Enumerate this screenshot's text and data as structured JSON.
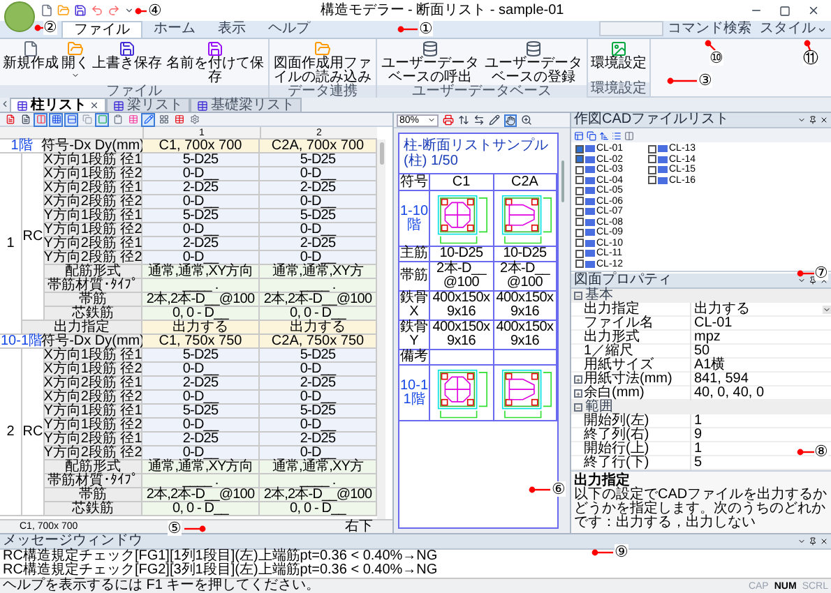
{
  "callouts": [
    "①",
    "②",
    "③",
    "④",
    "⑤",
    "⑥",
    "⑦",
    "⑧",
    "⑨",
    "⑩",
    "⑪"
  ],
  "window": {
    "title": "構造モデラー - 断面リスト - sample-01"
  },
  "menu_tabs": [
    {
      "label": "ファイル",
      "selected": true
    },
    {
      "label": "ホーム",
      "selected": false
    },
    {
      "label": "表示",
      "selected": false
    },
    {
      "label": "ヘルプ",
      "selected": false
    }
  ],
  "command_search": {
    "label": "コマンド検索"
  },
  "style_menu": {
    "label": "スタイル"
  },
  "ribbon": [
    {
      "label": "ファイル",
      "buttons": [
        {
          "label": "新規作成",
          "kind": "new",
          "dropdown": false
        },
        {
          "label": "開く",
          "kind": "open",
          "dropdown": true
        },
        {
          "label": "上書き保存",
          "kind": "save",
          "dropdown": false
        },
        {
          "label": "名前を付けて保存",
          "kind": "saveas",
          "dropdown": false
        }
      ]
    },
    {
      "label": "データ連携",
      "buttons": [
        {
          "label": "図面作成用ファイルの読み込み",
          "kind": "open",
          "dropdown": false
        }
      ]
    },
    {
      "label": "ユーザーデータベース",
      "buttons": [
        {
          "label": "ユーザーデータベースの呼出",
          "kind": "database",
          "dropdown": false
        },
        {
          "label": "ユーザーデータベースの登録",
          "kind": "database",
          "dropdown": false
        }
      ]
    },
    {
      "label": "環境設定",
      "buttons": [
        {
          "label": "環境設定",
          "kind": "image",
          "dropdown": false
        }
      ]
    }
  ],
  "doc_tabs": [
    {
      "label": "柱リスト",
      "selected": true,
      "closable": true
    },
    {
      "label": "梁リスト",
      "selected": false,
      "closable": false
    },
    {
      "label": "基礎梁リスト",
      "selected": false,
      "closable": false
    }
  ],
  "grid": {
    "toolbar": [
      {
        "selected": false
      },
      {
        "selected": false
      },
      {
        "selected": true
      },
      {
        "selected": true
      },
      {
        "selected": true
      },
      {
        "selected": false
      },
      {
        "selected": true
      },
      {
        "selected": false
      },
      {
        "selected": false
      },
      {
        "selected": true
      },
      {
        "selected": false
      },
      {
        "selected": false
      },
      {
        "selected": false
      }
    ],
    "columns": [
      "1",
      "2"
    ],
    "sections": [
      {
        "floor": "1階",
        "number": "1",
        "material": "RC",
        "code_label": "符号-Dx Dy(mm)",
        "values": [
          "C1, 700x 700",
          "C2A, 700x 700"
        ],
        "rows": [
          {
            "label": "X方向1段筋 径1",
            "kind": "bar",
            "values": [
              "5-D25",
              "5-D25"
            ]
          },
          {
            "label": "X方向1段筋 径2",
            "kind": "bar",
            "values": [
              "0-D__",
              "0-D__"
            ]
          },
          {
            "label": "X方向2段筋 径1",
            "kind": "bar",
            "values": [
              "2-D25",
              "2-D25"
            ]
          },
          {
            "label": "X方向2段筋 径2",
            "kind": "bar",
            "values": [
              "0-D__",
              "0-D__"
            ]
          },
          {
            "label": "Y方向1段筋 径1",
            "kind": "bar",
            "values": [
              "5-D25",
              "5-D25"
            ]
          },
          {
            "label": "Y方向1段筋 径2",
            "kind": "bar",
            "values": [
              "0-D__",
              "0-D__"
            ]
          },
          {
            "label": "Y方向2段筋 径1",
            "kind": "bar",
            "values": [
              "2-D25",
              "2-D25"
            ]
          },
          {
            "label": "Y方向2段筋 径2",
            "kind": "bar",
            "values": [
              "0-D__",
              "0-D__"
            ]
          },
          {
            "label": "配筋形式",
            "kind": "detail",
            "values": [
              "通常,通常,XY方向",
              "通常,通常,XY方"
            ]
          },
          {
            "label": "帯筋材質･ﾀｲﾌﾟ",
            "kind": "detail",
            "values": [
              "____ .",
              "____ ."
            ]
          },
          {
            "label": "帯筋",
            "kind": "detail",
            "values": [
              "2本,2本-D__@100",
              "2本,2本-D__@100"
            ]
          },
          {
            "label": "芯鉄筋",
            "kind": "detail",
            "values": [
              "0, 0 - D__",
              "0, 0 - D__"
            ]
          }
        ],
        "output": {
          "label": "出力指定",
          "values": [
            "出力する",
            "出力する"
          ]
        }
      },
      {
        "floor": "10-1階",
        "number": "2",
        "material": "RC",
        "code_label": "符号-Dx Dy(mm)",
        "values": [
          "C1, 750x 750",
          "C2A, 750x 750"
        ],
        "rows": [
          {
            "label": "X方向1段筋 径1",
            "kind": "bar",
            "values": [
              "5-D25",
              "5-D25"
            ]
          },
          {
            "label": "X方向1段筋 径2",
            "kind": "bar",
            "values": [
              "0-D__",
              "0-D__"
            ]
          },
          {
            "label": "X方向2段筋 径1",
            "kind": "bar",
            "values": [
              "2-D25",
              "2-D25"
            ]
          },
          {
            "label": "X方向2段筋 径2",
            "kind": "bar",
            "values": [
              "0-D__",
              "0-D__"
            ]
          },
          {
            "label": "Y方向1段筋 径1",
            "kind": "bar",
            "values": [
              "5-D25",
              "5-D25"
            ]
          },
          {
            "label": "Y方向1段筋 径2",
            "kind": "bar",
            "values": [
              "0-D__",
              "0-D__"
            ]
          },
          {
            "label": "Y方向2段筋 径1",
            "kind": "bar",
            "values": [
              "2-D25",
              "2-D25"
            ]
          },
          {
            "label": "Y方向2段筋 径2",
            "kind": "bar",
            "values": [
              "0-D__",
              "0-D__"
            ]
          },
          {
            "label": "配筋形式",
            "kind": "detail",
            "values": [
              "通常,通常,XY方向",
              "通常,通常,XY方"
            ]
          },
          {
            "label": "帯筋材質･ﾀｲﾌﾟ",
            "kind": "detail",
            "values": [
              "____ .",
              "____ ."
            ]
          },
          {
            "label": "帯筋",
            "kind": "detail",
            "values": [
              "2本,2本-D__@100",
              "2本,2本-D__@100"
            ]
          },
          {
            "label": "芯鉄筋",
            "kind": "detail",
            "values": [
              "0, 0 - D__",
              "0, 0 - D__"
            ]
          }
        ]
      }
    ],
    "footer": {
      "left": "C1, 700x 700",
      "right": "右下"
    }
  },
  "preview": {
    "zoom": "80%",
    "title": "柱-断面リストサンプル(柱) 1/50",
    "header": [
      "符号",
      "C1",
      "C2A"
    ],
    "groups": [
      {
        "label": "1-10階",
        "sections": [
          {
            "kind": "octagon"
          },
          {
            "kind": "trapezoid"
          }
        ],
        "rows": [
          {
            "label": "主筋",
            "values": [
              "10-D25",
              "10-D25"
            ]
          },
          {
            "label": "帯筋",
            "values": [
              "2本-D__@100",
              "2本-D__@100"
            ]
          },
          {
            "label": "鉄骨X",
            "values": [
              "400x150x 9x16",
              "400x150x 9x16"
            ]
          },
          {
            "label": "鉄骨Y",
            "values": [
              "400x150x 9x16",
              "400x150x 9x16"
            ]
          },
          {
            "label": "備考"
          }
        ]
      },
      {
        "label": "10-11階",
        "sections": [
          {
            "kind": "octagon"
          },
          {
            "kind": "trapezoid"
          }
        ]
      }
    ]
  },
  "cad_files": {
    "title": "作図CADファイルリスト",
    "items": [
      {
        "label": "CL-01",
        "checked": true
      },
      {
        "label": "CL-02",
        "checked": true
      },
      {
        "label": "CL-03",
        "checked": false
      },
      {
        "label": "CL-04",
        "checked": false
      },
      {
        "label": "CL-05",
        "checked": false
      },
      {
        "label": "CL-06",
        "checked": false
      },
      {
        "label": "CL-07",
        "checked": false
      },
      {
        "label": "CL-08",
        "checked": false
      },
      {
        "label": "CL-09",
        "checked": false
      },
      {
        "label": "CL-10",
        "checked": false
      },
      {
        "label": "CL-11",
        "checked": false
      },
      {
        "label": "CL-12",
        "checked": false
      },
      {
        "label": "CL-13",
        "checked": false
      },
      {
        "label": "CL-14",
        "checked": false
      },
      {
        "label": "CL-15",
        "checked": false
      },
      {
        "label": "CL-16",
        "checked": false
      }
    ]
  },
  "properties": {
    "title": "図面プロパティ",
    "categories": [
      {
        "label": "基本",
        "expanded": true,
        "rows": [
          {
            "label": "出力指定",
            "value": "出力する",
            "kind": "dropdown",
            "expandable": false
          },
          {
            "label": "ファイル名",
            "value": "CL-01",
            "kind": "text",
            "expandable": false
          },
          {
            "label": "出力形式",
            "value": "mpz",
            "kind": "text",
            "expandable": false
          },
          {
            "label": "1／縮尺",
            "value": "50",
            "kind": "text",
            "expandable": false
          },
          {
            "label": "用紙サイズ",
            "value": "A1横",
            "kind": "text",
            "expandable": false
          },
          {
            "label": "用紙寸法(mm)",
            "value": "841, 594",
            "kind": "text",
            "expandable": true
          },
          {
            "label": "余白(mm)",
            "value": "40, 0, 40, 0",
            "kind": "text",
            "expandable": true
          }
        ]
      },
      {
        "label": "範囲",
        "expanded": true,
        "rows": [
          {
            "label": "開始列(左)",
            "value": "1",
            "kind": "text",
            "expandable": false
          },
          {
            "label": "終了列(右)",
            "value": "9",
            "kind": "text",
            "expandable": false
          },
          {
            "label": "開始行(上)",
            "value": "1",
            "kind": "text",
            "expandable": false
          },
          {
            "label": "終了行(下)",
            "value": "5",
            "kind": "text",
            "expandable": false
          }
        ]
      }
    ],
    "description": {
      "title": "出力指定",
      "text": "以下の設定でCADファイルを出力するかどうかを指定します。次のうちのどれかです：出力する，出力しない"
    }
  },
  "messages": {
    "title": "メッセージウィンドウ",
    "lines": [
      "RC構造規定チェック[FG1][1列1段目](左)上端筋pt=0.36 < 0.40%→NG",
      "RC構造規定チェック[FG2][3列1段目](左)上端筋pt=0.36 < 0.40%→NG"
    ]
  },
  "status_bar": {
    "text": "ヘルプを表示するには F1 キーを押してください。",
    "indicators": [
      {
        "label": "CAP",
        "on": false
      },
      {
        "label": "NUM",
        "on": true
      },
      {
        "label": "SCRL",
        "on": false
      }
    ]
  }
}
